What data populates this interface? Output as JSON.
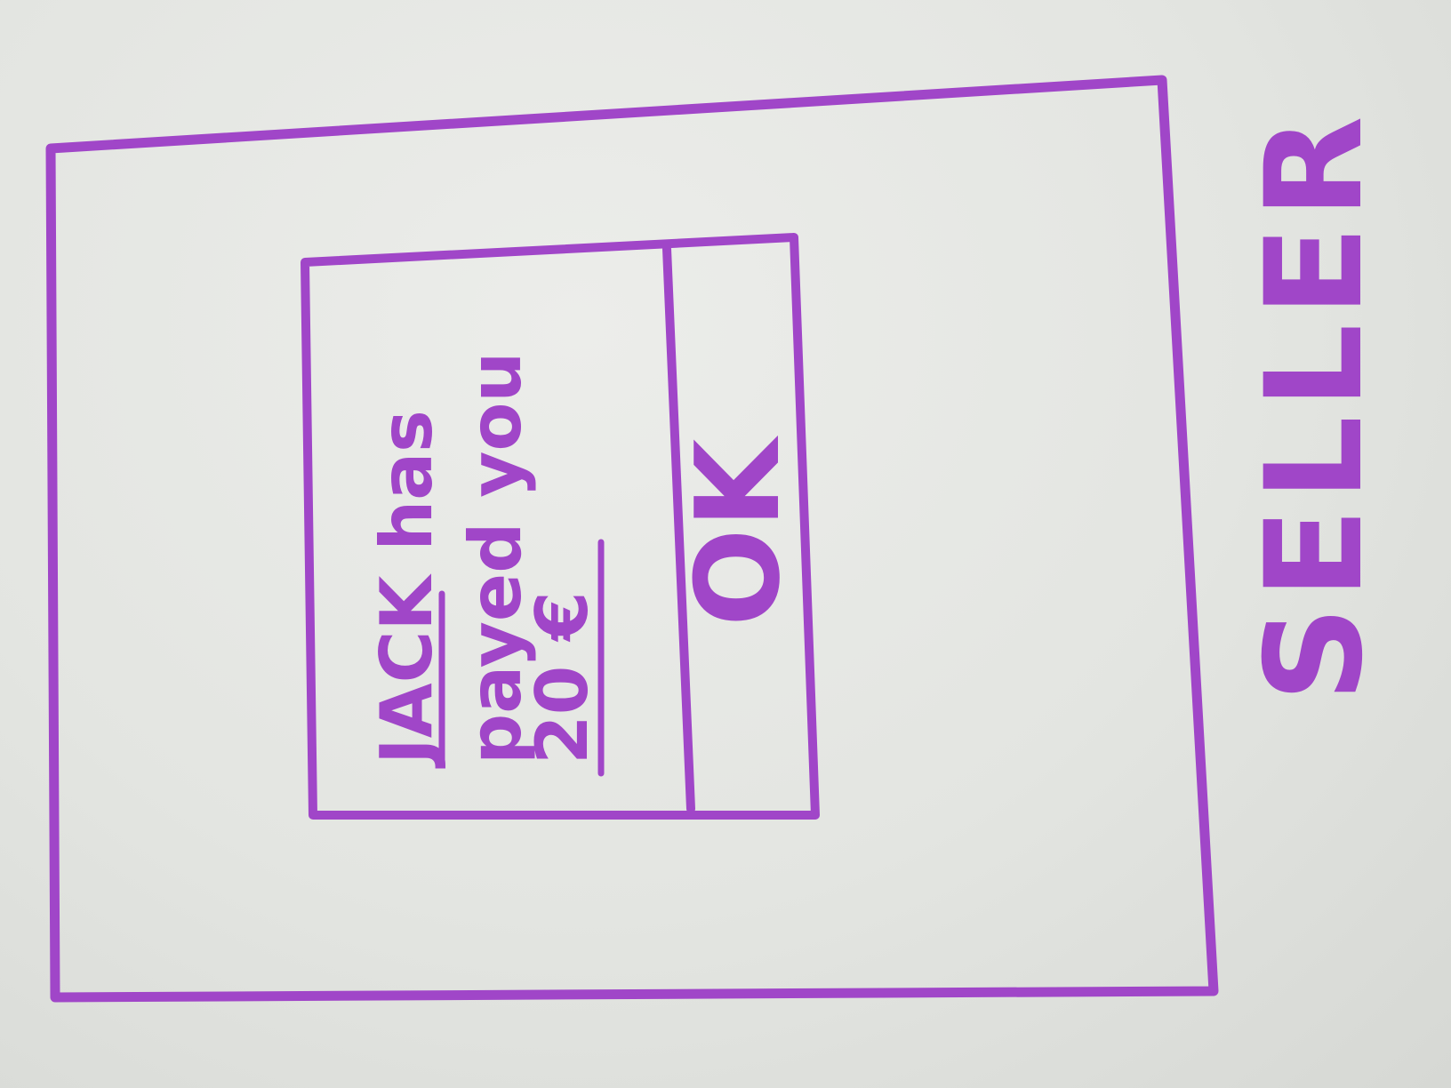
{
  "screen": {
    "label": "SELLER",
    "ink_color": "#a046c8"
  },
  "notification": {
    "message": {
      "payer": "JACK",
      "line1_rest": " has",
      "line2": "payed you",
      "amount": "20 €"
    },
    "ok_button_label": "OK"
  }
}
